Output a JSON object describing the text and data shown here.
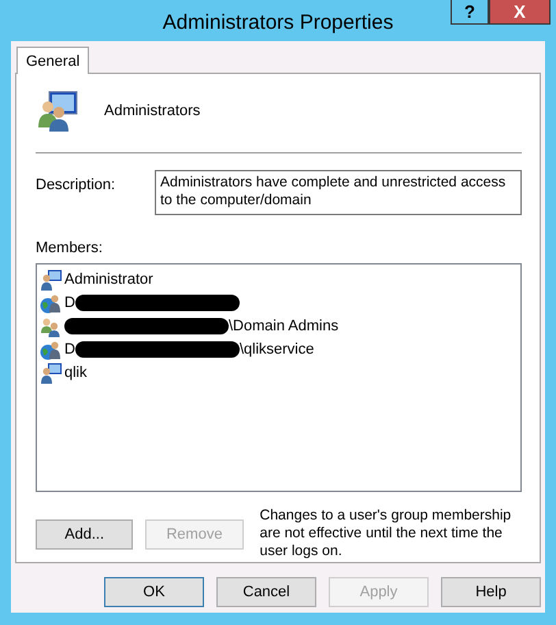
{
  "window": {
    "title": "Administrators Properties",
    "help_button": "?",
    "close_button": "X"
  },
  "tabs": [
    {
      "label": "General",
      "selected": true
    }
  ],
  "group": {
    "name": "Administrators"
  },
  "description": {
    "label": "Description:",
    "value": "Administrators have complete and unrestricted access to the computer/domain"
  },
  "members": {
    "label": "Members:",
    "items": [
      {
        "kind": "local-user",
        "before": "Administrator",
        "redacted": false
      },
      {
        "kind": "domain-user",
        "before": "D",
        "redacted": true
      },
      {
        "kind": "group",
        "after": "\\Domain Admins",
        "redacted": true
      },
      {
        "kind": "domain-user",
        "before": "D",
        "after": "\\qlikservice",
        "redacted": true
      },
      {
        "kind": "local-user",
        "before": "qlik",
        "redacted": false
      }
    ]
  },
  "member_buttons": [
    {
      "label": "Add...",
      "disabled": false
    },
    {
      "label": "Remove",
      "disabled": true
    }
  ],
  "note": "Changes to a user's group membership are not effective until the next time the user logs on.",
  "buttons": [
    {
      "label": "OK",
      "disabled": false,
      "default": true
    },
    {
      "label": "Cancel",
      "disabled": false,
      "default": false
    },
    {
      "label": "Apply",
      "disabled": true,
      "default": false
    },
    {
      "label": "Help",
      "disabled": false,
      "default": false
    }
  ]
}
